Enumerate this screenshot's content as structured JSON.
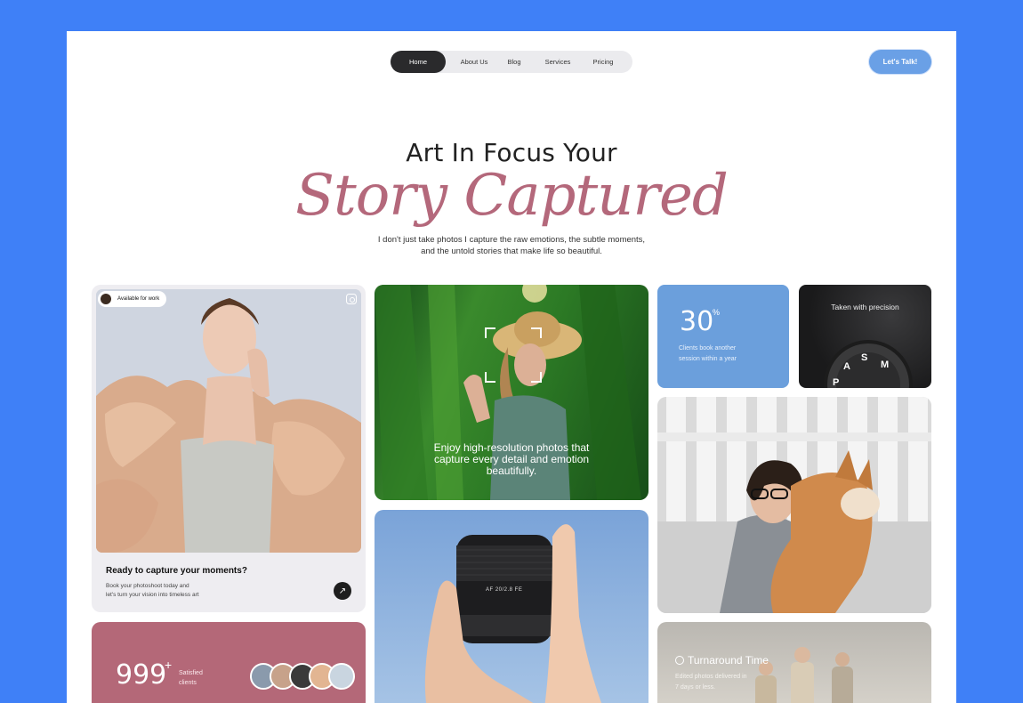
{
  "nav": {
    "items": [
      {
        "label": "Home",
        "active": true
      },
      {
        "label": "About Us"
      },
      {
        "label": "Blog"
      },
      {
        "label": "Services"
      },
      {
        "label": "Pricing"
      }
    ]
  },
  "cta_label": "Let's Talk!",
  "hero": {
    "line1": "Art In Focus Your",
    "line2": "Story Captured",
    "subtitle_1": "I don't just take photos I capture the raw emotions, the subtle moments,",
    "subtitle_2": "and the untold stories that make life so beautiful."
  },
  "card_portrait": {
    "badge": "Available for work",
    "icon": "instagram-icon",
    "title": "Ready to capture your moments?",
    "text_1": "Book your photoshoot today and",
    "text_2": "let's turn your vision into timeless art",
    "arrow": "↗"
  },
  "card_clients": {
    "number": "999",
    "plus": "+",
    "label_1": "Satisfied",
    "label_2": "clients"
  },
  "card_corn": {
    "text_1": "Enjoy high-resolution photos that",
    "text_2": "capture every detail and emotion",
    "text_3": "beautifully."
  },
  "card_stat": {
    "number": "30",
    "symbol": "%",
    "text_1": "Clients book another",
    "text_2": "session within a year"
  },
  "card_camera": {
    "title": "Taken with precision",
    "dial_letters": [
      "S",
      "M",
      "A",
      "P"
    ]
  },
  "card_lens": {
    "lens_text": "AF 20/2.8 FE"
  },
  "card_turnaround": {
    "title": "Turnaround Time",
    "text_1": "Edited photos delivered in",
    "text_2": "7 days or less."
  },
  "colors": {
    "background": "#3f80f7",
    "accent_rose": "#b4687b",
    "accent_blue": "#6aa0e6",
    "dark": "#2a2a2c"
  }
}
